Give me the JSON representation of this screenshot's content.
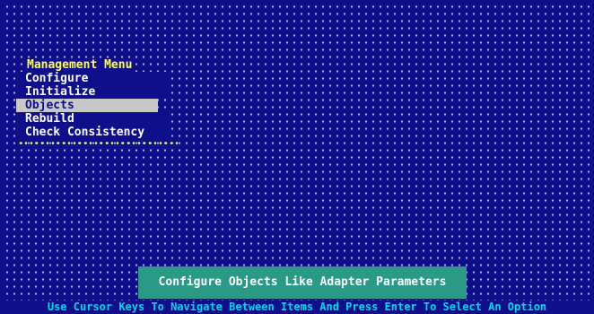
{
  "menu": {
    "title": "Management Menu",
    "items": [
      {
        "label": "Configure"
      },
      {
        "label": "Initialize"
      },
      {
        "label": "Objects"
      },
      {
        "label": "Rebuild"
      },
      {
        "label": "Check Consistency"
      }
    ],
    "selected_index": 2
  },
  "hint": {
    "text": "Configure Objects Like Adapter Parameters"
  },
  "status_bar": {
    "text": "Use Cursor Keys To Navigate Between Items And Press Enter To Select An Option"
  },
  "colors": {
    "background": "#0f0f8c",
    "menu_title": "#ffff55",
    "selection": "#c8c8c8",
    "hint_box": "#2a9a86",
    "status_text": "#00d8e8"
  }
}
